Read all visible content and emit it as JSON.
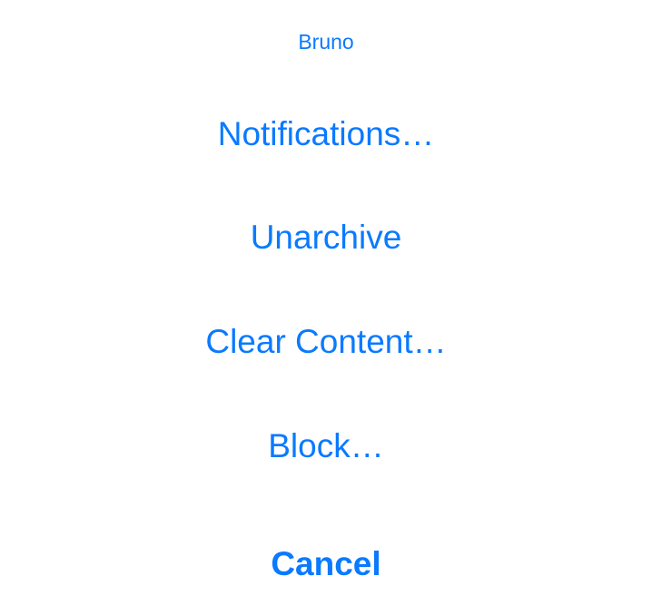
{
  "sheet": {
    "title": "Bruno",
    "actions": [
      {
        "label": "Notifications…"
      },
      {
        "label": "Unarchive"
      },
      {
        "label": "Clear Content…"
      },
      {
        "label": "Block…"
      }
    ],
    "cancel_label": "Cancel"
  },
  "colors": {
    "accent": "#0a7aff",
    "background": "#ffffff"
  }
}
